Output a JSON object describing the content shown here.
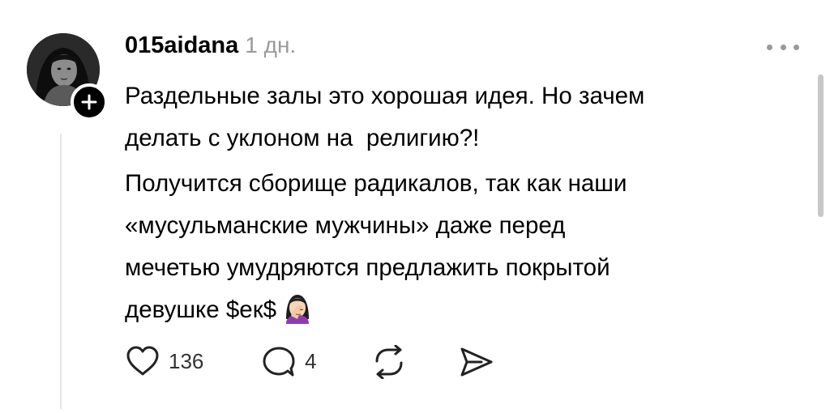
{
  "post": {
    "username": "015aidana",
    "timestamp": "1 дн.",
    "paragraphs": [
      "Раздельные залы это хорошая идея. Но зачем\nделать с уклоном на  религию?!",
      "Получится сборище радикалов, так как наши\n«мусульманские мужчины» даже перед\nмечетью умудряются предлажить покрытой\nдевушке $ек$"
    ],
    "emoji": "woman-facepalming-emoji",
    "likes": "136",
    "replies": "4"
  },
  "icons": {
    "like": "heart-icon",
    "reply": "speech-bubble-icon",
    "repost": "repost-icon",
    "share": "send-icon",
    "follow": "plus-icon",
    "more": "ellipsis-icon"
  },
  "colors": {
    "text": "#000000",
    "muted": "#9a9a9a",
    "thread_line": "#e4e4e4"
  }
}
